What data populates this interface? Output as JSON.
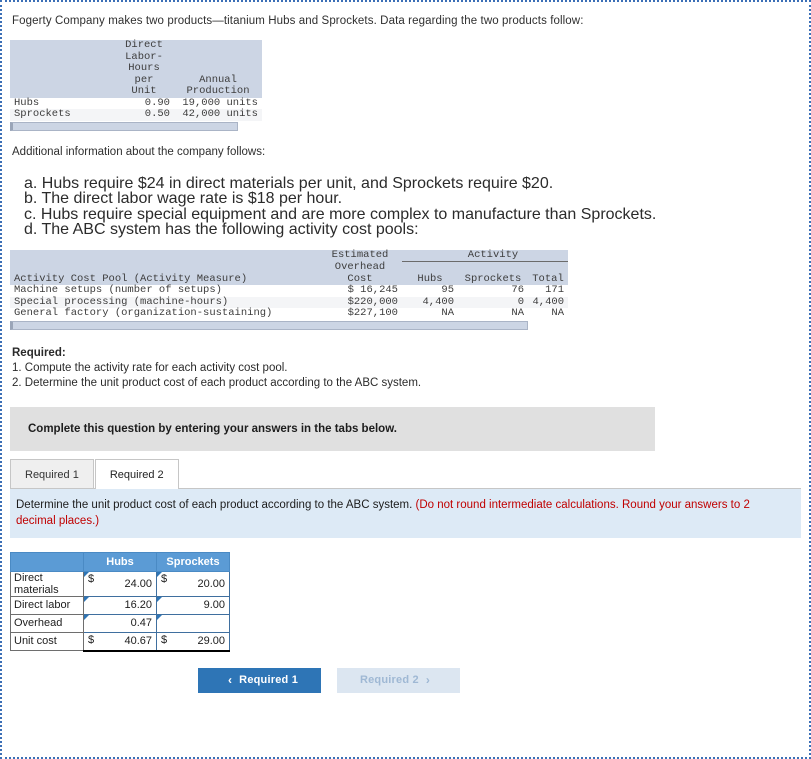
{
  "intro": "Fogerty Company makes two products—titanium Hubs and Sprockets. Data regarding the two products follow:",
  "product_table": {
    "headers": [
      "",
      "Direct Labor-Hours per Unit",
      "Annual Production"
    ],
    "header_lines": {
      "col1": [
        "Direct",
        "Labor-",
        "Hours",
        "per",
        "Unit"
      ],
      "col2": [
        "",
        "",
        "",
        "Annual",
        "Production"
      ]
    },
    "rows": [
      {
        "name": "Hubs",
        "dlh_per_unit": "0.90",
        "annual_production": "19,000 units"
      },
      {
        "name": "Sprockets",
        "dlh_per_unit": "0.50",
        "annual_production": "42,000 units"
      }
    ]
  },
  "additional_info_heading": "Additional information about the company follows:",
  "additional_info_items": [
    "a. Hubs require $24 in direct materials per unit, and Sprockets require $20.",
    "b. The direct labor wage rate is $18 per hour.",
    "c. Hubs require special equipment and are more complex to manufacture than Sprockets.",
    "d. The ABC system has the following activity cost pools:"
  ],
  "activity_table": {
    "group_header": "Activity",
    "headers": {
      "pool": "Activity Cost Pool (Activity Measure)",
      "cost_line1": "Estimated",
      "cost_line2": "Overhead",
      "cost_line3": "Cost",
      "hubs": "Hubs",
      "sprockets": "Sprockets",
      "total": "Total"
    },
    "rows": [
      {
        "pool": "Machine setups (number of setups)",
        "cost": "$ 16,245",
        "hubs": "95",
        "sprockets": "76",
        "total": "171"
      },
      {
        "pool": "Special processing (machine-hours)",
        "cost": "$220,000",
        "hubs": "4,400",
        "sprockets": "0",
        "total": "4,400"
      },
      {
        "pool": "General factory (organization-sustaining)",
        "cost": "$227,100",
        "hubs": "NA",
        "sprockets": "NA",
        "total": "NA"
      }
    ]
  },
  "required": {
    "title": "Required:",
    "items": [
      "1. Compute the activity rate for each activity cost pool.",
      "2. Determine the unit product cost of each product according to the ABC system."
    ]
  },
  "banner": "Complete this question by entering your answers in the tabs below.",
  "tabs": [
    {
      "label": "Required 1",
      "active": false
    },
    {
      "label": "Required 2",
      "active": true
    }
  ],
  "instruction": {
    "text": "Determine the unit product cost of each product according to the ABC system. ",
    "note": "(Do not round intermediate calculations. Round your answers to 2 decimal places.)"
  },
  "answer_table": {
    "corner": "",
    "columns": [
      "Hubs",
      "Sprockets"
    ],
    "rows": [
      {
        "label": "Direct materials",
        "hubs_symbol": "$",
        "hubs": "24.00",
        "sprockets_symbol": "$",
        "sprockets": "20.00",
        "total": false
      },
      {
        "label": "Direct labor",
        "hubs_symbol": "",
        "hubs": "16.20",
        "sprockets_symbol": "",
        "sprockets": "9.00",
        "total": false
      },
      {
        "label": "Overhead",
        "hubs_symbol": "",
        "hubs": "0.47",
        "sprockets_symbol": "",
        "sprockets": "",
        "total": false
      },
      {
        "label": "Unit cost",
        "hubs_symbol": "$",
        "hubs": "40.67",
        "sprockets_symbol": "$",
        "sprockets": "29.00",
        "total": true
      }
    ]
  },
  "nav": {
    "prev_label": "Required 1",
    "prev_chevron": "‹",
    "next_label": "Required 2",
    "next_chevron": "›"
  },
  "colors": {
    "header_blue": "#5b9bd5",
    "banner_grey": "#e0e0e0",
    "info_blue": "#ddeaf6",
    "note_red": "#c00000",
    "table_band": "#ccd5e4",
    "button_blue": "#2e75b6",
    "button_disabled": "#dce6f1"
  }
}
